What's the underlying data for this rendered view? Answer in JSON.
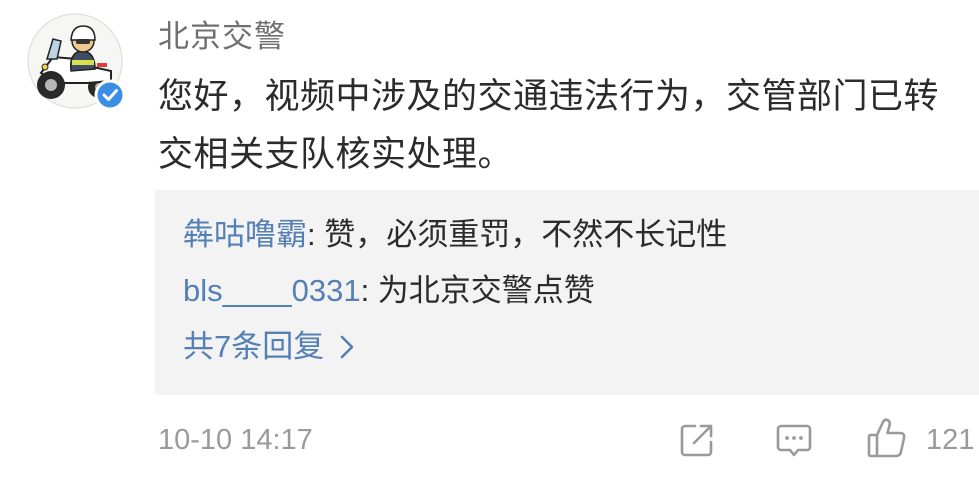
{
  "comment": {
    "author": {
      "name": "北京交警",
      "avatar_icon": "police-motorcycle-icon",
      "badge_icon": "verified-badge-icon"
    },
    "text": "您好，视频中涉及的交通违法行为，交管部门已转交相关支队核实处理。",
    "replies": [
      {
        "user": "犇咕噜霸",
        "text": ": 赞，必须重罚，不然不长记性"
      },
      {
        "user": "bls____0331",
        "text": ": 为北京交警点赞"
      }
    ],
    "more_replies": {
      "label": "共7条回复",
      "icon": "chevron-right-icon"
    },
    "timestamp": "10-10 14:17",
    "actions": {
      "share_icon": "share-icon",
      "comment_icon": "comment-icon",
      "like_icon": "thumbs-up-icon",
      "like_count": "121"
    }
  },
  "colors": {
    "link": "#5580b6",
    "text": "#2b2b2b",
    "username": "#6f6f6f",
    "muted": "#9a9a9a",
    "reply_bg": "#f3f3f3",
    "verified": "#3a8ee6"
  }
}
